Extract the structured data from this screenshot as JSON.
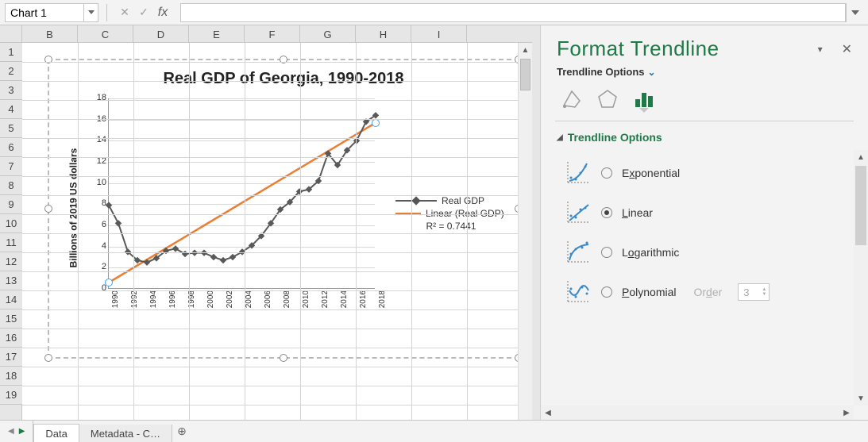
{
  "formula_bar": {
    "name_box": "Chart 1",
    "fx_label": "fx",
    "input_value": ""
  },
  "columns": [
    "B",
    "C",
    "D",
    "E",
    "F",
    "G",
    "H",
    "I"
  ],
  "rows": [
    1,
    2,
    3,
    4,
    5,
    6,
    7,
    8,
    9,
    10,
    11,
    12,
    13,
    14,
    15,
    16,
    17,
    18,
    19
  ],
  "chart": {
    "title": "Real GDP of Georgia, 1990-2018",
    "ylabel": "Billions of  2019 US dollars",
    "yticks": [
      0,
      2,
      4,
      6,
      8,
      10,
      12,
      14,
      16,
      18
    ],
    "xticks": [
      1990,
      1992,
      1994,
      1996,
      1998,
      2000,
      2002,
      2004,
      2006,
      2008,
      2010,
      2012,
      2014,
      2016,
      2018
    ],
    "legend_series": "Real GDP",
    "legend_trend": "Linear (Real GDP)",
    "r2_label": "R² = 0.7441"
  },
  "pane": {
    "title": "Format Trendline",
    "subtitle": "Trendline Options",
    "section": "Trendline Options",
    "options": {
      "exponential": "Exponential",
      "linear": "Linear",
      "logarithmic": "Logarithmic",
      "polynomial": "Polynomial",
      "order_label": "Order",
      "order_value": "3"
    },
    "selected": "linear"
  },
  "tabs": {
    "active": "Data",
    "second": "Metadata - C…"
  },
  "chart_data": {
    "type": "line",
    "title": "Real GDP of Georgia, 1990-2018",
    "xlabel": "",
    "ylabel": "Billions of 2019 US dollars",
    "ylim": [
      0,
      18
    ],
    "xlim": [
      1990,
      2018
    ],
    "x": [
      1990,
      1991,
      1992,
      1993,
      1994,
      1995,
      1996,
      1997,
      1998,
      1999,
      2000,
      2001,
      2002,
      2003,
      2004,
      2005,
      2006,
      2007,
      2008,
      2009,
      2010,
      2011,
      2012,
      2013,
      2014,
      2015,
      2016,
      2017,
      2018
    ],
    "series": [
      {
        "name": "Real GDP",
        "values": [
          7.9,
          6.2,
          3.5,
          2.7,
          2.5,
          2.9,
          3.6,
          3.8,
          3.3,
          3.4,
          3.4,
          3.0,
          2.7,
          3.0,
          3.5,
          4.1,
          5.0,
          6.2,
          7.5,
          8.2,
          9.2,
          9.4,
          10.2,
          12.8,
          11.7,
          13.1,
          14.0,
          15.8,
          16.4
        ],
        "marker": "diamond",
        "color": "#595959"
      }
    ],
    "trendline": {
      "type": "linear",
      "r_squared": 0.7441,
      "legend": "Linear (Real GDP)",
      "color": "#ed7d31",
      "start_x": 1990,
      "start_y": 0.6,
      "end_x": 2018,
      "end_y": 15.7
    }
  }
}
